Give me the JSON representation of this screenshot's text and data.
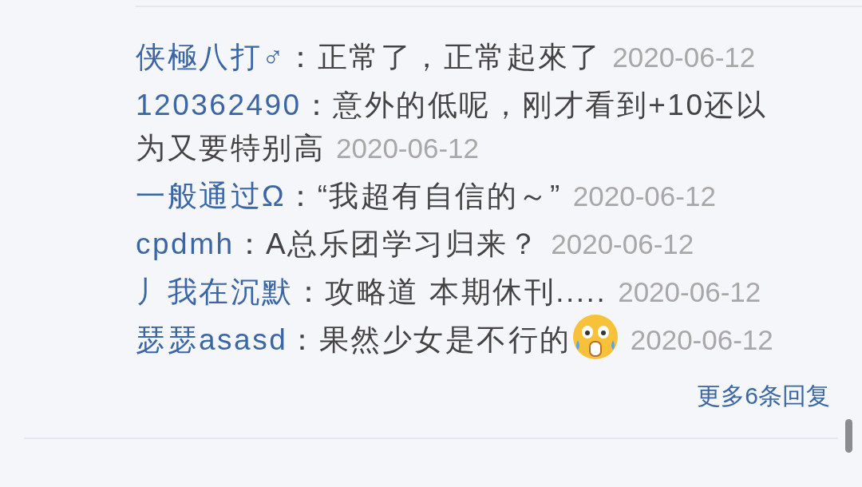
{
  "replies": [
    {
      "user": "侠極八打♂",
      "text": "：正常了，正常起來了",
      "date": "2020-06-12",
      "emoji": false
    },
    {
      "user": "120362490",
      "text": "：意外的低呢，刚才看到+10还以",
      "text_continued": "为又要特别高",
      "date": "2020-06-12",
      "emoji": false
    },
    {
      "user": "一般通过Ω",
      "text": "：“我超有自信的～”",
      "date": "2020-06-12",
      "emoji": false
    },
    {
      "user": "cpdmh",
      "text": "：A总乐团学习归来？",
      "date": "2020-06-12",
      "emoji": false
    },
    {
      "user": "丿我在沉默",
      "text": "：攻略道 本期休刊.....",
      "date": "2020-06-12",
      "emoji": false
    },
    {
      "user": "瑟瑟asasd",
      "text": "：果然少女是不行的",
      "date": "2020-06-12",
      "emoji": true
    }
  ],
  "more_link": "更多6条回复"
}
